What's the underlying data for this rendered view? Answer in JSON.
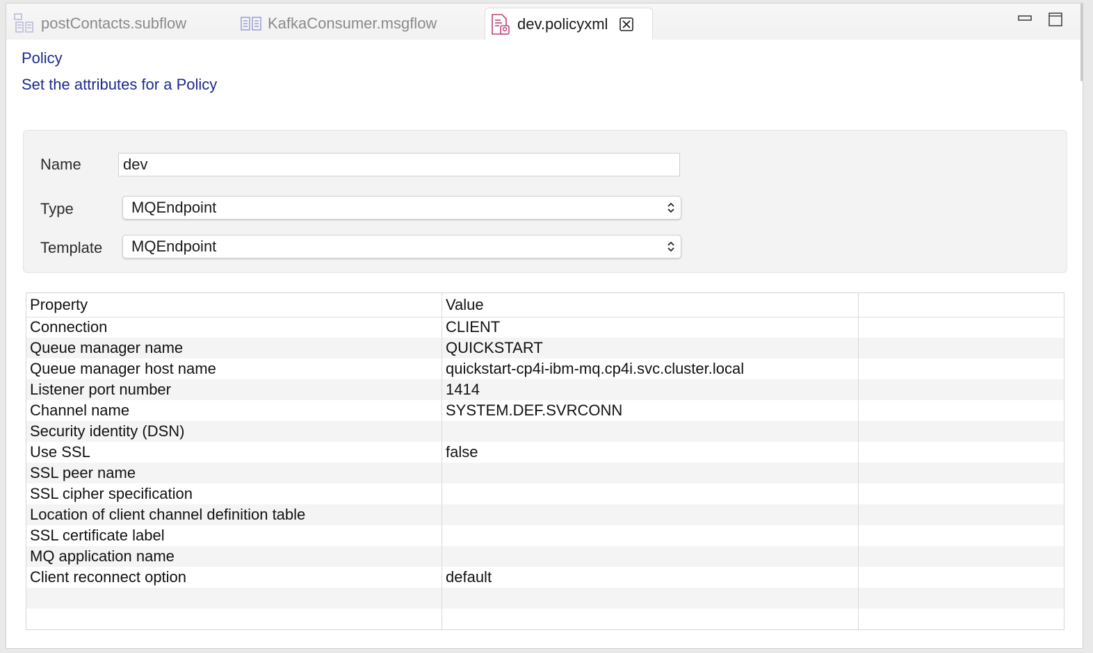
{
  "tabs": [
    {
      "label": "postContacts.subflow",
      "icon": "subflow-icon",
      "active": false
    },
    {
      "label": "KafkaConsumer.msgflow",
      "icon": "msgflow-icon",
      "active": false
    },
    {
      "label": "dev.policyxml",
      "icon": "policy-file-icon",
      "active": true
    }
  ],
  "window_controls": [
    "minimize-icon",
    "maximize-icon"
  ],
  "header": {
    "title": "Policy",
    "subtitle": "Set the attributes for a Policy"
  },
  "form": {
    "name_label": "Name",
    "name_value": "dev",
    "type_label": "Type",
    "type_value": "MQEndpoint",
    "template_label": "Template",
    "template_value": "MQEndpoint"
  },
  "table": {
    "columns": [
      "Property",
      "Value",
      ""
    ],
    "rows": [
      {
        "property": "Connection",
        "value": "CLIENT"
      },
      {
        "property": "Queue manager name",
        "value": "QUICKSTART"
      },
      {
        "property": "Queue manager host name",
        "value": "quickstart-cp4i-ibm-mq.cp4i.svc.cluster.local"
      },
      {
        "property": "Listener port number",
        "value": "1414"
      },
      {
        "property": "Channel name",
        "value": "SYSTEM.DEF.SVRCONN"
      },
      {
        "property": "Security identity (DSN)",
        "value": ""
      },
      {
        "property": "Use SSL",
        "value": "false"
      },
      {
        "property": "SSL peer name",
        "value": ""
      },
      {
        "property": "SSL cipher specification",
        "value": ""
      },
      {
        "property": "Location of client channel definition table",
        "value": ""
      },
      {
        "property": "SSL certificate label",
        "value": ""
      },
      {
        "property": "MQ application name",
        "value": ""
      },
      {
        "property": "Client reconnect option",
        "value": "default"
      }
    ]
  },
  "colors": {
    "heading": "#1a2a8c",
    "policy_icon": "#c0407a",
    "flow_icon": "#8f8fd0"
  }
}
